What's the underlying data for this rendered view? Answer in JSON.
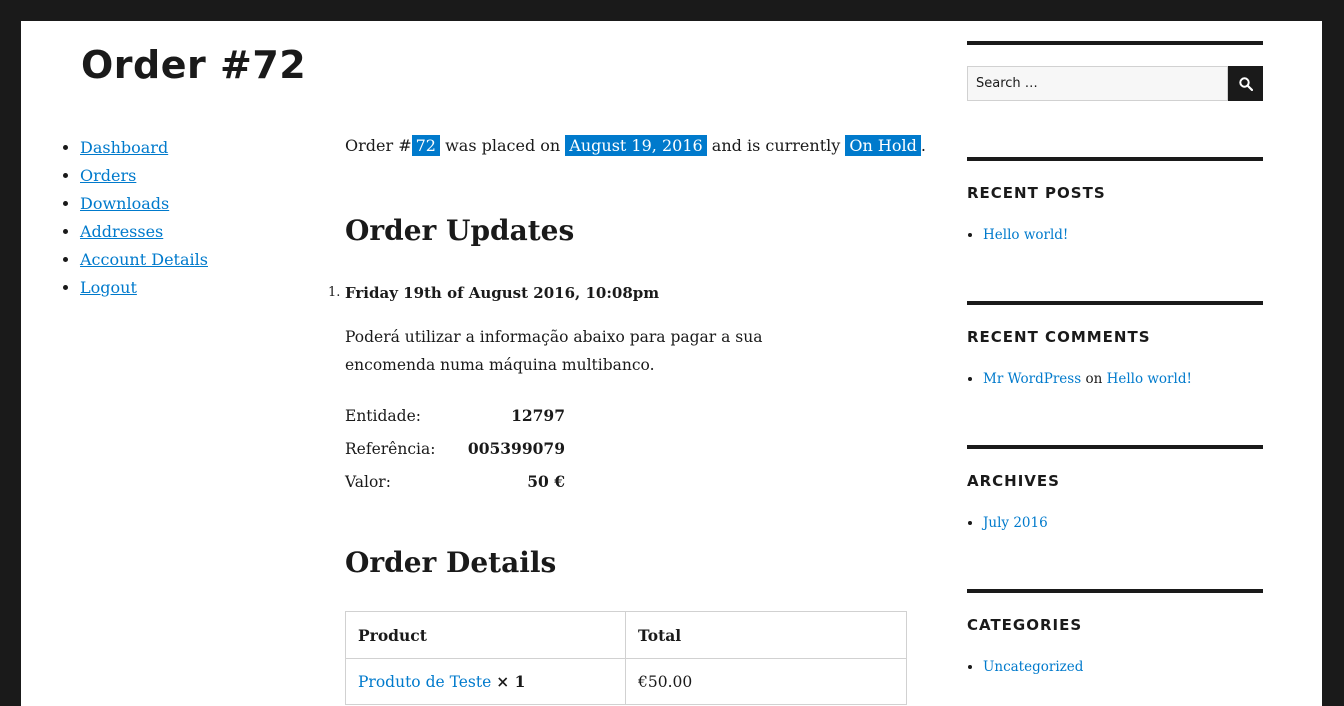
{
  "page": {
    "title": "Order #72"
  },
  "account_nav": {
    "items": [
      {
        "label": "Dashboard"
      },
      {
        "label": "Orders"
      },
      {
        "label": "Downloads"
      },
      {
        "label": "Addresses"
      },
      {
        "label": "Account Details"
      },
      {
        "label": "Logout"
      }
    ]
  },
  "order": {
    "intro_prefix": "Order #",
    "number": "72",
    "intro_mid": "was placed on",
    "date": "August 19, 2016",
    "intro_status_prefix": "and is currently",
    "status": "On Hold",
    "intro_suffix": "."
  },
  "updates": {
    "heading": "Order Updates",
    "items": [
      {
        "num": "1.",
        "date": "Friday 19th of August 2016, 10:08pm",
        "text": "Poderá utilizar a informação abaixo para pagar a sua encomenda numa máquina multibanco.",
        "payment": [
          {
            "label": "Entidade:",
            "value": "12797"
          },
          {
            "label": "Referência:",
            "value": "005399079"
          },
          {
            "label": "Valor:",
            "value": "50 €"
          }
        ]
      }
    ]
  },
  "details": {
    "heading": "Order Details",
    "columns": [
      "Product",
      "Total"
    ],
    "rows": [
      {
        "product": "Produto de Teste",
        "qty": "× 1",
        "total": "€50.00"
      }
    ]
  },
  "sidebar": {
    "search_placeholder": "Search …",
    "recent_posts": {
      "title": "RECENT POSTS",
      "items": [
        "Hello world!"
      ]
    },
    "recent_comments": {
      "title": "RECENT COMMENTS",
      "author": "Mr WordPress",
      "on": "on",
      "post": "Hello world!"
    },
    "archives": {
      "title": "ARCHIVES",
      "items": [
        "July 2016"
      ]
    },
    "categories": {
      "title": "CATEGORIES",
      "items": [
        "Uncategorized"
      ]
    }
  },
  "colors": {
    "accent": "#007acc",
    "frame": "#1a1a1a",
    "text": "#1a1a1a"
  }
}
